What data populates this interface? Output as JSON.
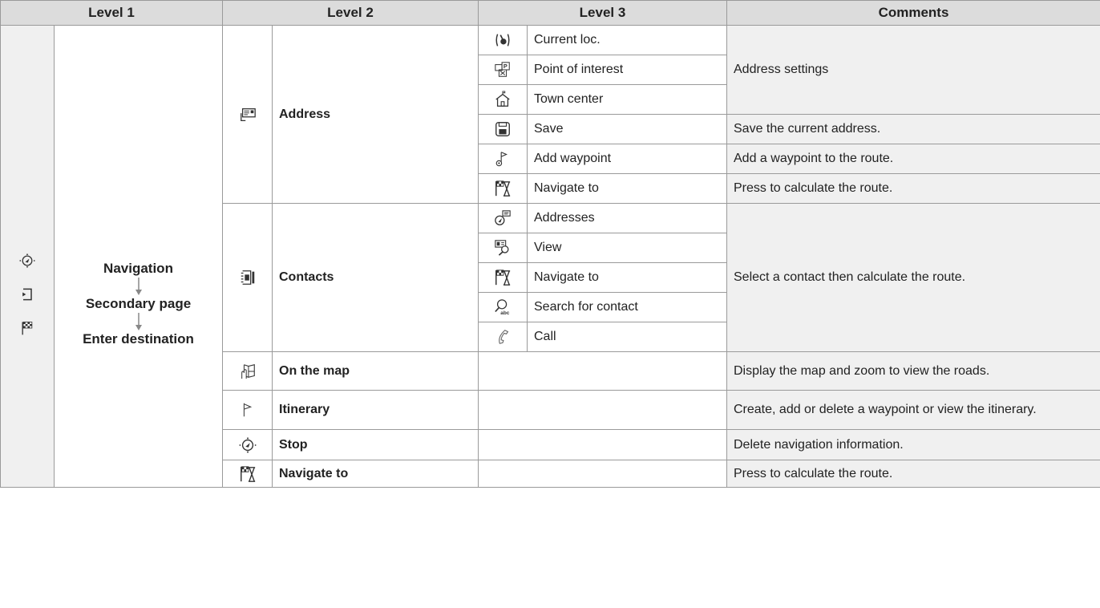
{
  "headers": {
    "level1": "Level 1",
    "level2": "Level 2",
    "level3": "Level 3",
    "comments": "Comments"
  },
  "level1": {
    "icons": [
      "navigation-compass-icon",
      "secondary-page-icon",
      "destination-flag-icon"
    ],
    "path": [
      "Navigation",
      "Secondary page",
      "Enter destination"
    ]
  },
  "groups": {
    "address": {
      "label": "Address",
      "icon": "address-card-icon",
      "items": [
        {
          "icon": "current-location-icon",
          "label": "Current loc."
        },
        {
          "icon": "point-of-interest-icon",
          "label": "Point of interest"
        },
        {
          "icon": "town-center-icon",
          "label": "Town center"
        },
        {
          "icon": "save-icon",
          "label": "Save"
        },
        {
          "icon": "add-waypoint-icon",
          "label": "Add waypoint"
        },
        {
          "icon": "navigate-to-icon",
          "label": "Navigate to"
        }
      ],
      "comments": [
        "Address settings",
        "Save the current address.",
        "Add a waypoint to the route.",
        "Press to calculate the route."
      ]
    },
    "contacts": {
      "label": "Contacts",
      "icon": "contacts-book-icon",
      "items": [
        {
          "icon": "addresses-icon",
          "label": "Addresses"
        },
        {
          "icon": "view-contact-icon",
          "label": "View"
        },
        {
          "icon": "navigate-to-icon",
          "label": "Navigate to"
        },
        {
          "icon": "search-contact-icon",
          "label": "Search for contact"
        },
        {
          "icon": "phone-icon",
          "label": "Call"
        }
      ],
      "comment": "Select a contact then calculate the route."
    },
    "on_map": {
      "label": "On the map",
      "icon": "map-touch-icon",
      "comment": "Display the map and zoom to view the roads."
    },
    "itinerary": {
      "label": "Itinerary",
      "icon": "flag-icon",
      "comment": "Create, add or delete a waypoint or view the itinerary."
    },
    "stop": {
      "label": "Stop",
      "icon": "navigation-compass-icon",
      "comment": "Delete navigation information."
    },
    "navigate": {
      "label": "Navigate to",
      "icon": "navigate-to-icon",
      "comment": "Press to calculate the route."
    }
  }
}
